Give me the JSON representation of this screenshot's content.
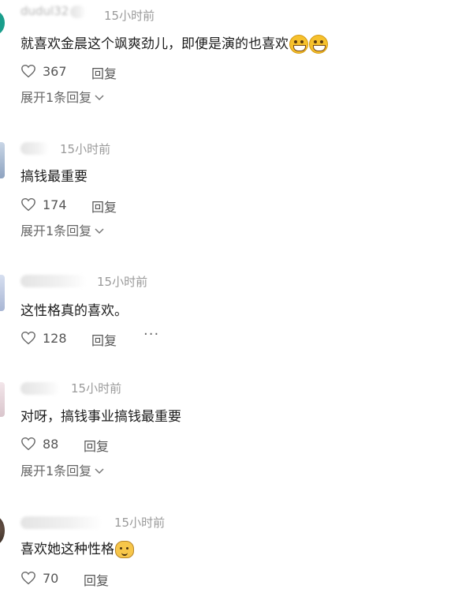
{
  "comments": [
    {
      "username": "dudul32",
      "time": "15小时前",
      "text": "就喜欢金晨这个飒爽劲儿，即便是演的也喜欢",
      "emoji_icons": [
        "grin-emoji-icon",
        "grin-emoji-icon"
      ],
      "likes": "367",
      "reply_label": "回复",
      "expand_label": "展开1条回复"
    },
    {
      "time": "15小时前",
      "text": "搞钱最重要",
      "likes": "174",
      "reply_label": "回复",
      "expand_label": "展开1条回复"
    },
    {
      "time": "15小时前",
      "text": "这性格真的喜欢。",
      "likes": "128",
      "reply_label": "回复",
      "more_label": "···"
    },
    {
      "time": "15小时前",
      "text": "对呀，搞钱事业搞钱最重要",
      "likes": "88",
      "reply_label": "回复",
      "expand_label": "展开1条回复"
    },
    {
      "time": "15小时前",
      "text": "喜欢她这种性格",
      "emoji_icons": [
        "cat-emoji-icon"
      ],
      "likes": "70",
      "reply_label": "回复"
    }
  ],
  "colors": {
    "secondary_text": "#9a9a9a",
    "action_text": "#555555",
    "avatar_teal": "#1a9e8c"
  }
}
